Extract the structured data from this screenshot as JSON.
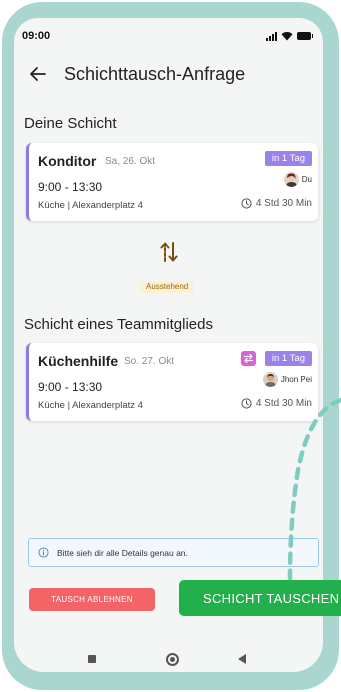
{
  "status_bar": {
    "time": "09:00"
  },
  "app_bar": {
    "title": "Schichttausch-Anfrage",
    "back_icon": "arrow-left-icon"
  },
  "my_shift": {
    "section_title": "Deine Schicht",
    "role": "Konditor",
    "date": "Sa, 26. Okt",
    "badge": "in 1 Tag",
    "user_name": "Du",
    "time": "9:00 - 13:30",
    "location": "Küche | Alexanderplatz 4",
    "duration": "4 Std 30 Min"
  },
  "swap": {
    "icon": "swap-arrows-icon",
    "status": "Ausstehend"
  },
  "colleague_shift": {
    "section_title": "Schicht eines Teammitglieds",
    "role": "Küchenhilfe",
    "date": "So. 27. Okt",
    "badge": "in 1 Tag",
    "user_name": "Jhon Pei",
    "time": "9:00 - 13:30",
    "location": "Küche | Alexanderplatz 4",
    "duration": "4 Std 30 Min"
  },
  "info": {
    "text": "Bitte sieh dir alle Details genau an."
  },
  "actions": {
    "reject_label": "TAUSCH ABLEHNEN",
    "accept_label": "SCHICHT TAUSCHEN"
  },
  "colors": {
    "frame": "#a9d6cf",
    "accent_purple": "#9a82e8",
    "swap_pink": "#d565d4",
    "reject_red": "#f26466",
    "accept_green": "#21b04b",
    "pending_text": "#9a6a00",
    "pending_bg": "#fbf1d9",
    "info_border": "#9ec6ef"
  }
}
